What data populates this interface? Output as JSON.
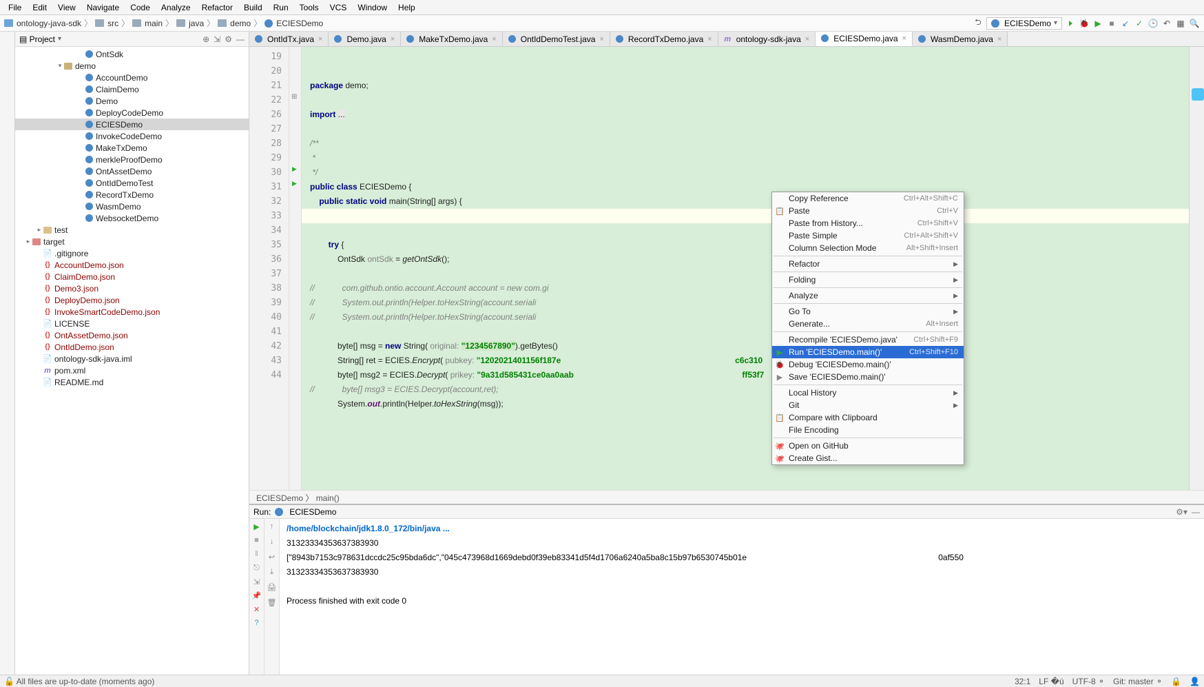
{
  "menu": {
    "items": [
      "File",
      "Edit",
      "View",
      "Navigate",
      "Code",
      "Analyze",
      "Refactor",
      "Build",
      "Run",
      "Tools",
      "VCS",
      "Window",
      "Help"
    ]
  },
  "breadcrumb": {
    "items": [
      "ontology-java-sdk",
      "src",
      "main",
      "java",
      "demo",
      "ECIESDemo"
    ]
  },
  "runconfig": "ECIESDemo",
  "project": {
    "label": "Project",
    "items": [
      {
        "ind": 90,
        "ico": "class",
        "label": "OntSdk"
      },
      {
        "ind": 60,
        "exp": "▾",
        "ico": "folder open",
        "label": "demo"
      },
      {
        "ind": 90,
        "ico": "class",
        "label": "AccountDemo"
      },
      {
        "ind": 90,
        "ico": "class",
        "label": "ClaimDemo"
      },
      {
        "ind": 90,
        "ico": "class",
        "label": "Demo"
      },
      {
        "ind": 90,
        "ico": "class",
        "label": "DeployCodeDemo"
      },
      {
        "ind": 90,
        "ico": "class",
        "label": "ECIESDemo",
        "sel": true
      },
      {
        "ind": 90,
        "ico": "class",
        "label": "InvokeCodeDemo"
      },
      {
        "ind": 90,
        "ico": "class",
        "label": "MakeTxDemo"
      },
      {
        "ind": 90,
        "ico": "class",
        "label": "merkleProofDemo"
      },
      {
        "ind": 90,
        "ico": "class",
        "label": "OntAssetDemo"
      },
      {
        "ind": 90,
        "ico": "class",
        "label": "OntIdDemoTest"
      },
      {
        "ind": 90,
        "ico": "class",
        "label": "RecordTxDemo"
      },
      {
        "ind": 90,
        "ico": "class",
        "label": "WasmDemo"
      },
      {
        "ind": 90,
        "ico": "class",
        "label": "WebsocketDemo"
      },
      {
        "ind": 30,
        "exp": "▸",
        "ico": "folder",
        "label": "test"
      },
      {
        "ind": 14,
        "exp": "▸",
        "ico": "folder red",
        "label": "target"
      },
      {
        "ind": 30,
        "ico": "file",
        "label": ".gitignore"
      },
      {
        "ind": 30,
        "ico": "json",
        "label": "AccountDemo.json",
        "mod": true
      },
      {
        "ind": 30,
        "ico": "json",
        "label": "ClaimDemo.json",
        "mod": true
      },
      {
        "ind": 30,
        "ico": "json",
        "label": "Demo3.json",
        "mod": true
      },
      {
        "ind": 30,
        "ico": "json",
        "label": "DeployDemo.json",
        "mod": true
      },
      {
        "ind": 30,
        "ico": "json",
        "label": "InvokeSmartCodeDemo.json",
        "mod": true
      },
      {
        "ind": 30,
        "ico": "file",
        "label": "LICENSE"
      },
      {
        "ind": 30,
        "ico": "json",
        "label": "OntAssetDemo.json",
        "mod": true
      },
      {
        "ind": 30,
        "ico": "json",
        "label": "OntIdDemo.json",
        "mod": true
      },
      {
        "ind": 30,
        "ico": "file",
        "label": "ontology-sdk-java.iml"
      },
      {
        "ind": 30,
        "ico": "m",
        "label": "pom.xml"
      },
      {
        "ind": 30,
        "ico": "file",
        "label": "README.md"
      }
    ]
  },
  "tabs": [
    {
      "label": "OntIdTx.java"
    },
    {
      "label": "Demo.java"
    },
    {
      "label": "MakeTxDemo.java"
    },
    {
      "label": "OntIdDemoTest.java"
    },
    {
      "label": "RecordTxDemo.java"
    },
    {
      "label": "ontology-sdk-java",
      "m": true
    },
    {
      "label": "ECIESDemo.java",
      "act": true
    },
    {
      "label": "WasmDemo.java"
    }
  ],
  "gutter": {
    "lines": [
      "19",
      "20",
      "21",
      "22",
      "26",
      "27",
      "28",
      "29",
      "30",
      "31",
      "32",
      "33",
      "34",
      "35",
      "36",
      "37",
      "38",
      "39",
      "40",
      "41",
      "42",
      "43",
      "44"
    ]
  },
  "code": {
    "l20": "package",
    "l20b": " demo;",
    "l22": "import ",
    "l22b": "...",
    "l27": "/**",
    "l28": " *",
    "l29": " */",
    "l30a": "public class",
    "l30b": " ECIESDemo {",
    "l31a": "    public static void",
    "l31b": " main(String[] args) {",
    "l33": "        try",
    " l33b": " {",
    "l34a": "            OntSdk ",
    "l34b": "ontSdk",
    "l34c": " = ",
    "l34d": "getOntSdk",
    "l34e": "();",
    "l36": "//            com.github.ontio.account.Account account = new com.gi",
    "l36b": "Helper",
    "l37": "//            System.out.println(Helper.toHexString(account.seriali",
    "l38": "//            System.out.println(Helper.toHexString(account.seriali",
    "l40a": "            byte[] msg = ",
    "l40b": "new",
    "l40c": " String(",
    "l40d": " original: ",
    "l40e": "\"1234567890\"",
    "l40f": ").getBytes()",
    "l41a": "            String[] ret = ECIES.",
    "l41b": "Encrypt",
    "l41c": "(",
    "l41d": " pubkey: ",
    "l41e": "\"1202021401156f187e",
    "l41f": "c6c310",
    "l42a": "            byte[] msg2 = ECIES.",
    "l42b": "Decrypt",
    "l42c": "(",
    "l42d": " prikey: ",
    "l42e": "\"9a31d585431ce0aa0aab",
    "l42f": "ff53f7",
    "l43": "//            byte[] msg3 = ECIES.Decrypt(account,ret);",
    "l44a": "            System.",
    "l44b": "out",
    "l44c": ".println(Helper.",
    "l44d": "toHexString",
    "l44e": "(msg));"
  },
  "bread2": "ECIESDemo  〉 main()",
  "runhdr": {
    "label": "Run:",
    "name": "ECIESDemo"
  },
  "console": {
    "l1": "/home/blockchain/jdk1.8.0_172/bin/java ...",
    "l2": "31323334353637383930",
    "l3": "[\"8943b7153c978631dccdc25c95bda6dc\",\"045c473968d1669debd0f39eb83341d5f4d1706a6240a5ba8c15b97b6530745b01e",
    "l3b": "0af550",
    "l4": "31323334353637383930",
    "l6": "Process finished with exit code 0"
  },
  "ctx": [
    {
      "t": "item",
      "label": "Copy Reference",
      "sc": "Ctrl+Alt+Shift+C"
    },
    {
      "t": "item",
      "label": "Paste",
      "sc": "Ctrl+V",
      "ico": "📋"
    },
    {
      "t": "item",
      "label": "Paste from History...",
      "sc": "Ctrl+Shift+V"
    },
    {
      "t": "item",
      "label": "Paste Simple",
      "sc": "Ctrl+Alt+Shift+V"
    },
    {
      "t": "item",
      "label": "Column Selection Mode",
      "sc": "Alt+Shift+Insert"
    },
    {
      "t": "sep"
    },
    {
      "t": "item",
      "label": "Refactor",
      "arr": true
    },
    {
      "t": "sep"
    },
    {
      "t": "item",
      "label": "Folding",
      "arr": true
    },
    {
      "t": "sep"
    },
    {
      "t": "item",
      "label": "Analyze",
      "arr": true
    },
    {
      "t": "sep"
    },
    {
      "t": "item",
      "label": "Go To",
      "arr": true
    },
    {
      "t": "item",
      "label": "Generate...",
      "sc": "Alt+Insert"
    },
    {
      "t": "sep"
    },
    {
      "t": "item",
      "label": "Recompile 'ECIESDemo.java'",
      "sc": "Ctrl+Shift+F9"
    },
    {
      "t": "item",
      "label": "Run 'ECIESDemo.main()'",
      "sc": "Ctrl+Shift+F10",
      "sel": true,
      "ico": "▶",
      "icocls": "green"
    },
    {
      "t": "item",
      "label": "Debug 'ECIESDemo.main()'",
      "ico": "🐞",
      "icocls": "green"
    },
    {
      "t": "item",
      "label": "Save 'ECIESDemo.main()'",
      "ico": "▶",
      "icocls": "gray"
    },
    {
      "t": "sep"
    },
    {
      "t": "item",
      "label": "Local History",
      "arr": true
    },
    {
      "t": "item",
      "label": "Git",
      "arr": true
    },
    {
      "t": "item",
      "label": "Compare with Clipboard",
      "ico": "📋"
    },
    {
      "t": "item",
      "label": "File Encoding"
    },
    {
      "t": "sep"
    },
    {
      "t": "item",
      "label": "Open on GitHub",
      "ico": "🐙"
    },
    {
      "t": "item",
      "label": "Create Gist...",
      "ico": "🐙"
    }
  ],
  "status": {
    "left": "All files are up-to-date (moments ago)",
    "pos": "32:1",
    "lf": "LF �ú",
    "enc": "UTF-8 ⚬",
    "git": "Git: master ⚬",
    "pad": "🔒"
  }
}
